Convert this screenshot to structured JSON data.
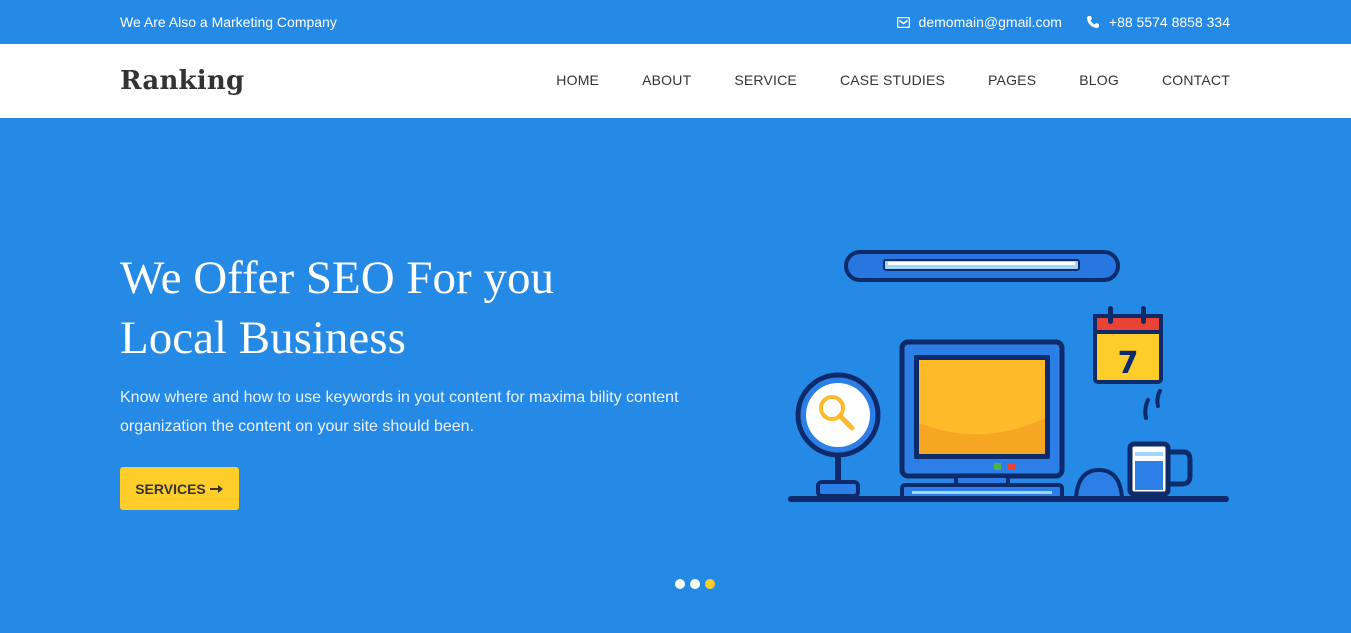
{
  "topbar": {
    "tagline": "We Are Also a Marketing Company",
    "email": {
      "icon": "envelope-icon",
      "text": "demomain@gmail.com"
    },
    "phone": {
      "icon": "phone-icon",
      "text": "+88 5574 8858 334"
    }
  },
  "nav": {
    "brand": "Ranking",
    "items": [
      {
        "label": "HOME"
      },
      {
        "label": "ABOUT"
      },
      {
        "label": "SERVICE"
      },
      {
        "label": "CASE STUDIES"
      },
      {
        "label": "PAGES"
      },
      {
        "label": "BLOG"
      },
      {
        "label": "CONTACT"
      }
    ]
  },
  "hero": {
    "title_line1": "We Offer SEO For you",
    "title_line2": "Local Business",
    "description": "Know where and how to use keywords in yout content for maxima bility content organization the content on your site should been.",
    "button_label": "SERVICES",
    "button_icon": "arrow-right-icon",
    "illustration": "desk-computer-illustration",
    "calendar_day": "7",
    "slider": {
      "count": 3,
      "active_index": 2
    }
  },
  "colors": {
    "primary_blue": "#2589e6",
    "accent_yellow": "#ffcd2a",
    "dark_navy": "#0d2a6b",
    "text_dark": "#333333",
    "white": "#ffffff"
  }
}
